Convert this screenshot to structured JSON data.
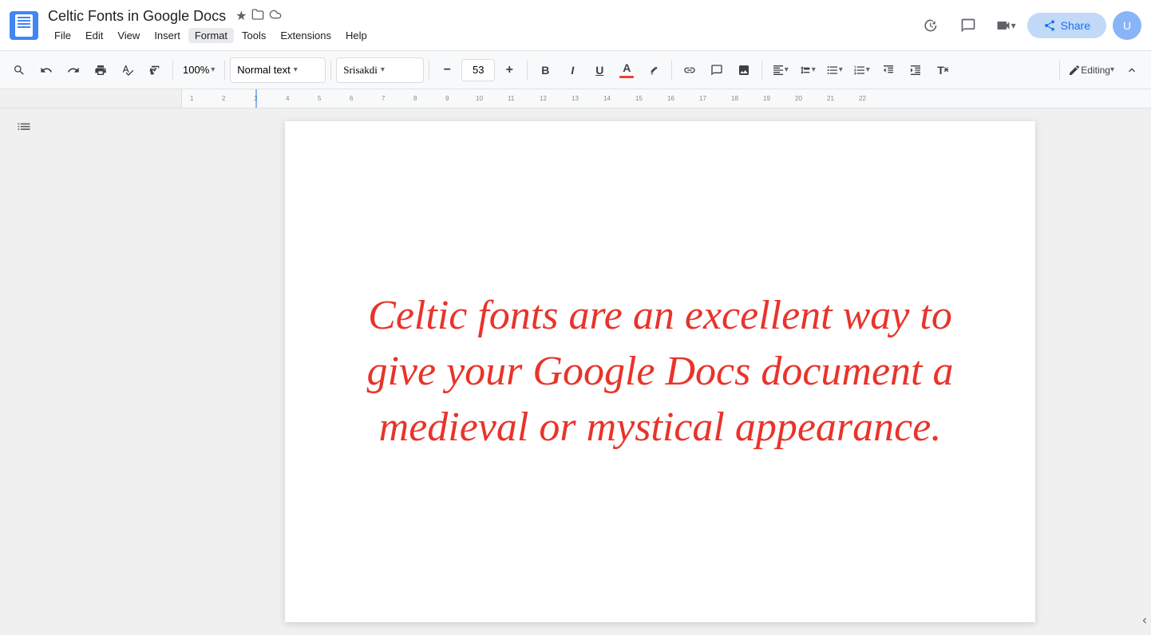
{
  "titleBar": {
    "docTitle": "Celtic Fonts in Google Docs",
    "starIcon": "★",
    "folderIcon": "📁",
    "cloudIcon": "☁",
    "menuItems": [
      "File",
      "Edit",
      "View",
      "Insert",
      "Format",
      "Tools",
      "Extensions",
      "Help"
    ],
    "shareLabel": "Share",
    "historyIcon": "⏱",
    "commentIcon": "💬",
    "meetIcon": "📹"
  },
  "toolbar": {
    "searchIcon": "🔍",
    "undoIcon": "↩",
    "redoIcon": "↪",
    "printIcon": "🖨",
    "spellcheckIcon": "✓",
    "paintIcon": "🖌",
    "zoomLabel": "100%",
    "textStyleLabel": "Normal text",
    "fontLabel": "Srisakdi",
    "fontSizeValue": "53",
    "minusIcon": "−",
    "plusIcon": "+",
    "boldLabel": "B",
    "italicLabel": "I",
    "underlineLabel": "U",
    "fontColorIcon": "A",
    "highlightIcon": "✏",
    "linkIcon": "🔗",
    "commentIcon": "💬",
    "imageIcon": "🖼",
    "alignIcon": "≡",
    "lineSpacingIcon": "↕",
    "listIcon": "≡",
    "numberedListIcon": "#",
    "decreaseIndentIcon": "←",
    "increaseIndentIcon": "→",
    "clearFormattingIcon": "T",
    "editingIcon": "✏",
    "collapseIcon": "▲"
  },
  "document": {
    "content": "Celtic fonts are an excellent way to give your Google Docs document a medieval or mystical appearance.",
    "fontFamily": "Georgia, serif",
    "fontSize": "52px",
    "color": "#e8342b",
    "textAlign": "center"
  },
  "sidebar": {
    "outlineIcon": "☰"
  }
}
